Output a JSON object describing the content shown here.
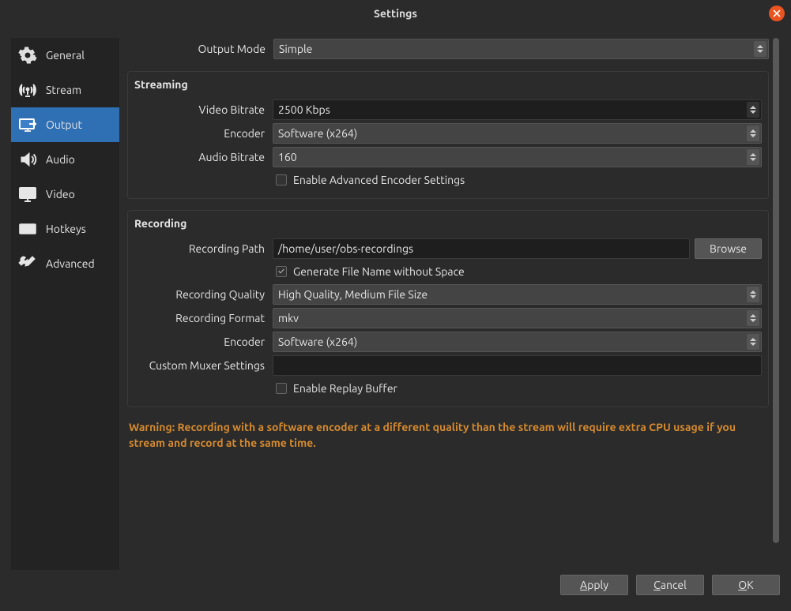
{
  "title": "Settings",
  "sidebar": {
    "items": [
      {
        "label": "General"
      },
      {
        "label": "Stream"
      },
      {
        "label": "Output"
      },
      {
        "label": "Audio"
      },
      {
        "label": "Video"
      },
      {
        "label": "Hotkeys"
      },
      {
        "label": "Advanced"
      }
    ]
  },
  "output_mode": {
    "label": "Output Mode",
    "value": "Simple"
  },
  "streaming": {
    "title": "Streaming",
    "video_bitrate": {
      "label": "Video Bitrate",
      "value": "2500 Kbps"
    },
    "encoder": {
      "label": "Encoder",
      "value": "Software (x264)"
    },
    "audio_bitrate": {
      "label": "Audio Bitrate",
      "value": "160"
    },
    "enable_advanced": {
      "label": "Enable Advanced Encoder Settings",
      "checked": false
    }
  },
  "recording": {
    "title": "Recording",
    "path": {
      "label": "Recording Path",
      "value": "/home/user/obs-recordings",
      "browse": "Browse"
    },
    "gen_no_space": {
      "label": "Generate File Name without Space",
      "checked": true
    },
    "quality": {
      "label": "Recording Quality",
      "value": "High Quality, Medium File Size"
    },
    "format": {
      "label": "Recording Format",
      "value": "mkv"
    },
    "encoder": {
      "label": "Encoder",
      "value": "Software (x264)"
    },
    "muxer": {
      "label": "Custom Muxer Settings",
      "value": ""
    },
    "replay_buffer": {
      "label": "Enable Replay Buffer",
      "checked": false
    }
  },
  "warning": "Warning: Recording with a software encoder at a different quality than the stream will require extra CPU usage if you stream and record at the same time.",
  "footer": {
    "apply": "Apply",
    "cancel": "Cancel",
    "ok": "OK"
  }
}
